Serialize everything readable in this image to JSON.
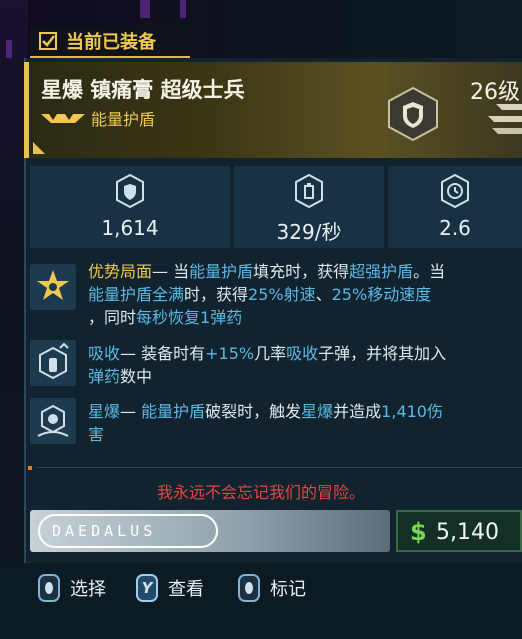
{
  "equipped_tag": {
    "label": "当前已装备",
    "icon": "check-icon"
  },
  "item": {
    "name": "星爆 镇痛膏 超级士兵",
    "level": "26级",
    "type": "能量护盾",
    "rarity_color": "#f0c850",
    "badge_icon": "shield-icon"
  },
  "stats": [
    {
      "icon": "shield-capacity-icon",
      "value": "1,614"
    },
    {
      "icon": "recharge-rate-icon",
      "value": "329/秒"
    },
    {
      "icon": "recharge-delay-icon",
      "value": "2.6"
    }
  ],
  "perks": [
    {
      "icon": "star-burst-icon",
      "lines": [
        [
          {
            "t": "优势局面",
            "c": "hl-y"
          },
          {
            "t": "— 当",
            "c": ""
          },
          {
            "t": "能量护盾",
            "c": "hl-b"
          },
          {
            "t": "填充时，获得",
            "c": ""
          },
          {
            "t": "超强护盾",
            "c": "hl-b"
          },
          {
            "t": "。当",
            "c": ""
          }
        ],
        [
          {
            "t": "能量护盾全满",
            "c": "hl-b"
          },
          {
            "t": "时，获得",
            "c": ""
          },
          {
            "t": "25%射速",
            "c": "hl-b"
          },
          {
            "t": "、",
            "c": ""
          },
          {
            "t": "25%移动速度",
            "c": "hl-b"
          }
        ],
        [
          {
            "t": "，同时",
            "c": ""
          },
          {
            "t": "每秒恢复1弹药",
            "c": "hl-b"
          }
        ]
      ]
    },
    {
      "icon": "ammo-absorb-icon",
      "lines": [
        [
          {
            "t": "吸收",
            "c": "hl-b"
          },
          {
            "t": "— 装备时有",
            "c": ""
          },
          {
            "t": "+15%",
            "c": "hl-b"
          },
          {
            "t": "几率",
            "c": ""
          },
          {
            "t": "吸收",
            "c": "hl-b"
          },
          {
            "t": "子弹，并将其加入",
            "c": ""
          }
        ],
        [
          {
            "t": "弹药",
            "c": "hl-b"
          },
          {
            "t": "数中",
            "c": ""
          }
        ]
      ]
    },
    {
      "icon": "nova-icon",
      "lines": [
        [
          {
            "t": "星爆",
            "c": "hl-b"
          },
          {
            "t": "— ",
            "c": ""
          },
          {
            "t": "能量护盾",
            "c": "hl-b"
          },
          {
            "t": "破裂时，触发",
            "c": ""
          },
          {
            "t": "星爆",
            "c": "hl-b"
          },
          {
            "t": "并造成",
            "c": ""
          },
          {
            "t": "1,410伤",
            "c": "hl-b"
          }
        ],
        [
          {
            "t": "害",
            "c": "hl-b"
          }
        ]
      ]
    }
  ],
  "flavor_text": "我永远不会忘记我们的冒险。",
  "manufacturer": "DAEDALUS",
  "price": {
    "currency": "$",
    "amount": "5,140"
  },
  "actions": [
    {
      "key": "",
      "label": "选择",
      "icon": "stick-button-icon"
    },
    {
      "key": "Y",
      "label": "查看",
      "icon": "y-button-icon"
    },
    {
      "key": "",
      "label": "标记",
      "icon": "stick-button-icon"
    }
  ]
}
